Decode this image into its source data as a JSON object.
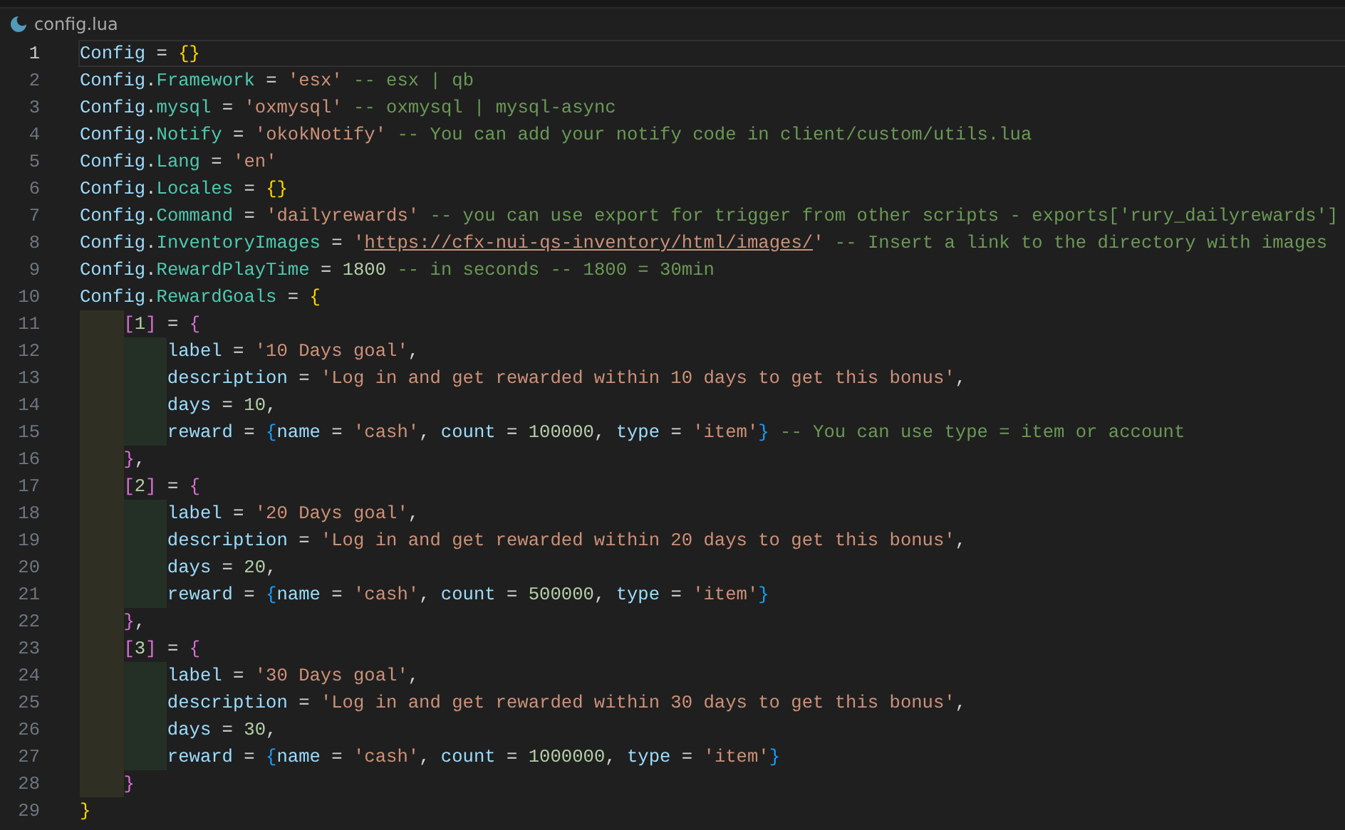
{
  "breadcrumb": {
    "file": "config.lua"
  },
  "lines": [
    {
      "number": "1",
      "active": true,
      "tokens": [
        {
          "kind": "var",
          "text": "Config"
        },
        {
          "kind": "op",
          "text": " = "
        },
        {
          "kind": "brace1",
          "text": "{}"
        }
      ]
    },
    {
      "number": "2",
      "active": false,
      "tokens": [
        {
          "kind": "var",
          "text": "Config"
        },
        {
          "kind": "op",
          "text": "."
        },
        {
          "kind": "field",
          "text": "Framework"
        },
        {
          "kind": "op",
          "text": " = "
        },
        {
          "kind": "str",
          "text": "'esx'"
        },
        {
          "kind": "comment",
          "text": " -- esx | qb"
        }
      ]
    },
    {
      "number": "3",
      "active": false,
      "tokens": [
        {
          "kind": "var",
          "text": "Config"
        },
        {
          "kind": "op",
          "text": "."
        },
        {
          "kind": "field",
          "text": "mysql"
        },
        {
          "kind": "op",
          "text": " = "
        },
        {
          "kind": "str",
          "text": "'oxmysql'"
        },
        {
          "kind": "comment",
          "text": " -- oxmysql | mysql-async"
        }
      ]
    },
    {
      "number": "4",
      "active": false,
      "tokens": [
        {
          "kind": "var",
          "text": "Config"
        },
        {
          "kind": "op",
          "text": "."
        },
        {
          "kind": "field",
          "text": "Notify"
        },
        {
          "kind": "op",
          "text": " = "
        },
        {
          "kind": "str",
          "text": "'okokNotify'"
        },
        {
          "kind": "comment",
          "text": " -- You can add your notify code in client/custom/utils.lua"
        }
      ]
    },
    {
      "number": "5",
      "active": false,
      "tokens": [
        {
          "kind": "var",
          "text": "Config"
        },
        {
          "kind": "op",
          "text": "."
        },
        {
          "kind": "field",
          "text": "Lang"
        },
        {
          "kind": "op",
          "text": " = "
        },
        {
          "kind": "str",
          "text": "'en'"
        }
      ]
    },
    {
      "number": "6",
      "active": false,
      "tokens": [
        {
          "kind": "var",
          "text": "Config"
        },
        {
          "kind": "op",
          "text": "."
        },
        {
          "kind": "field",
          "text": "Locales"
        },
        {
          "kind": "op",
          "text": " = "
        },
        {
          "kind": "brace1",
          "text": "{}"
        }
      ]
    },
    {
      "number": "7",
      "active": false,
      "tokens": [
        {
          "kind": "var",
          "text": "Config"
        },
        {
          "kind": "op",
          "text": "."
        },
        {
          "kind": "field",
          "text": "Command"
        },
        {
          "kind": "op",
          "text": " = "
        },
        {
          "kind": "str",
          "text": "'dailyrewards'"
        },
        {
          "kind": "comment",
          "text": " -- you can use export for trigger from other scripts - exports['rury_dailyrewards']"
        }
      ]
    },
    {
      "number": "8",
      "active": false,
      "tokens": [
        {
          "kind": "var",
          "text": "Config"
        },
        {
          "kind": "op",
          "text": "."
        },
        {
          "kind": "field",
          "text": "InventoryImages"
        },
        {
          "kind": "op",
          "text": " = "
        },
        {
          "kind": "str",
          "text": "'"
        },
        {
          "kind": "link",
          "text": "https://cfx-nui-qs-inventory/html/images/"
        },
        {
          "kind": "str",
          "text": "'"
        },
        {
          "kind": "comment",
          "text": " -- Insert a link to the directory with images"
        }
      ]
    },
    {
      "number": "9",
      "active": false,
      "tokens": [
        {
          "kind": "var",
          "text": "Config"
        },
        {
          "kind": "op",
          "text": "."
        },
        {
          "kind": "field",
          "text": "RewardPlayTime"
        },
        {
          "kind": "op",
          "text": " = "
        },
        {
          "kind": "num",
          "text": "1800"
        },
        {
          "kind": "comment",
          "text": " -- in seconds -- 1800 = 30min"
        }
      ]
    },
    {
      "number": "10",
      "active": false,
      "tokens": [
        {
          "kind": "var",
          "text": "Config"
        },
        {
          "kind": "op",
          "text": "."
        },
        {
          "kind": "field",
          "text": "RewardGoals"
        },
        {
          "kind": "op",
          "text": " = "
        },
        {
          "kind": "brace1",
          "text": "{"
        }
      ]
    },
    {
      "number": "11",
      "active": false,
      "tokens": [
        {
          "kind": "guide1"
        },
        {
          "kind": "brace2",
          "text": "["
        },
        {
          "kind": "num",
          "text": "1"
        },
        {
          "kind": "brace2",
          "text": "]"
        },
        {
          "kind": "op",
          "text": " = "
        },
        {
          "kind": "brace2",
          "text": "{"
        }
      ]
    },
    {
      "number": "12",
      "active": false,
      "tokens": [
        {
          "kind": "guide1"
        },
        {
          "kind": "guide2"
        },
        {
          "kind": "key",
          "text": "label"
        },
        {
          "kind": "op",
          "text": " = "
        },
        {
          "kind": "str",
          "text": "'10 Days goal'"
        },
        {
          "kind": "op",
          "text": ","
        }
      ]
    },
    {
      "number": "13",
      "active": false,
      "tokens": [
        {
          "kind": "guide1"
        },
        {
          "kind": "guide2"
        },
        {
          "kind": "key",
          "text": "description"
        },
        {
          "kind": "op",
          "text": " = "
        },
        {
          "kind": "str",
          "text": "'Log in and get rewarded within 10 days to get this bonus'"
        },
        {
          "kind": "op",
          "text": ","
        }
      ]
    },
    {
      "number": "14",
      "active": false,
      "tokens": [
        {
          "kind": "guide1"
        },
        {
          "kind": "guide2"
        },
        {
          "kind": "key",
          "text": "days"
        },
        {
          "kind": "op",
          "text": " = "
        },
        {
          "kind": "num",
          "text": "10"
        },
        {
          "kind": "op",
          "text": ","
        }
      ]
    },
    {
      "number": "15",
      "active": false,
      "tokens": [
        {
          "kind": "guide1"
        },
        {
          "kind": "guide2"
        },
        {
          "kind": "key",
          "text": "reward"
        },
        {
          "kind": "op",
          "text": " = "
        },
        {
          "kind": "brace3",
          "text": "{"
        },
        {
          "kind": "key",
          "text": "name"
        },
        {
          "kind": "op",
          "text": " = "
        },
        {
          "kind": "str",
          "text": "'cash'"
        },
        {
          "kind": "op",
          "text": ", "
        },
        {
          "kind": "key",
          "text": "count"
        },
        {
          "kind": "op",
          "text": " = "
        },
        {
          "kind": "num",
          "text": "100000"
        },
        {
          "kind": "op",
          "text": ", "
        },
        {
          "kind": "key",
          "text": "type"
        },
        {
          "kind": "op",
          "text": " = "
        },
        {
          "kind": "str",
          "text": "'item'"
        },
        {
          "kind": "brace3",
          "text": "}"
        },
        {
          "kind": "comment",
          "text": " -- You can use type = item or account"
        }
      ]
    },
    {
      "number": "16",
      "active": false,
      "tokens": [
        {
          "kind": "guide1"
        },
        {
          "kind": "brace2",
          "text": "}"
        },
        {
          "kind": "op",
          "text": ","
        }
      ]
    },
    {
      "number": "17",
      "active": false,
      "tokens": [
        {
          "kind": "guide1"
        },
        {
          "kind": "brace2",
          "text": "["
        },
        {
          "kind": "num",
          "text": "2"
        },
        {
          "kind": "brace2",
          "text": "]"
        },
        {
          "kind": "op",
          "text": " = "
        },
        {
          "kind": "brace2",
          "text": "{"
        }
      ]
    },
    {
      "number": "18",
      "active": false,
      "tokens": [
        {
          "kind": "guide1"
        },
        {
          "kind": "guide2"
        },
        {
          "kind": "key",
          "text": "label"
        },
        {
          "kind": "op",
          "text": " = "
        },
        {
          "kind": "str",
          "text": "'20 Days goal'"
        },
        {
          "kind": "op",
          "text": ","
        }
      ]
    },
    {
      "number": "19",
      "active": false,
      "tokens": [
        {
          "kind": "guide1"
        },
        {
          "kind": "guide2"
        },
        {
          "kind": "key",
          "text": "description"
        },
        {
          "kind": "op",
          "text": " = "
        },
        {
          "kind": "str",
          "text": "'Log in and get rewarded within 20 days to get this bonus'"
        },
        {
          "kind": "op",
          "text": ","
        }
      ]
    },
    {
      "number": "20",
      "active": false,
      "tokens": [
        {
          "kind": "guide1"
        },
        {
          "kind": "guide2"
        },
        {
          "kind": "key",
          "text": "days"
        },
        {
          "kind": "op",
          "text": " = "
        },
        {
          "kind": "num",
          "text": "20"
        },
        {
          "kind": "op",
          "text": ","
        }
      ]
    },
    {
      "number": "21",
      "active": false,
      "tokens": [
        {
          "kind": "guide1"
        },
        {
          "kind": "guide2"
        },
        {
          "kind": "key",
          "text": "reward"
        },
        {
          "kind": "op",
          "text": " = "
        },
        {
          "kind": "brace3",
          "text": "{"
        },
        {
          "kind": "key",
          "text": "name"
        },
        {
          "kind": "op",
          "text": " = "
        },
        {
          "kind": "str",
          "text": "'cash'"
        },
        {
          "kind": "op",
          "text": ", "
        },
        {
          "kind": "key",
          "text": "count"
        },
        {
          "kind": "op",
          "text": " = "
        },
        {
          "kind": "num",
          "text": "500000"
        },
        {
          "kind": "op",
          "text": ", "
        },
        {
          "kind": "key",
          "text": "type"
        },
        {
          "kind": "op",
          "text": " = "
        },
        {
          "kind": "str",
          "text": "'item'"
        },
        {
          "kind": "brace3",
          "text": "}"
        }
      ]
    },
    {
      "number": "22",
      "active": false,
      "tokens": [
        {
          "kind": "guide1"
        },
        {
          "kind": "brace2",
          "text": "}"
        },
        {
          "kind": "op",
          "text": ","
        }
      ]
    },
    {
      "number": "23",
      "active": false,
      "tokens": [
        {
          "kind": "guide1"
        },
        {
          "kind": "brace2",
          "text": "["
        },
        {
          "kind": "num",
          "text": "3"
        },
        {
          "kind": "brace2",
          "text": "]"
        },
        {
          "kind": "op",
          "text": " = "
        },
        {
          "kind": "brace2",
          "text": "{"
        }
      ]
    },
    {
      "number": "24",
      "active": false,
      "tokens": [
        {
          "kind": "guide1"
        },
        {
          "kind": "guide2"
        },
        {
          "kind": "key",
          "text": "label"
        },
        {
          "kind": "op",
          "text": " = "
        },
        {
          "kind": "str",
          "text": "'30 Days goal'"
        },
        {
          "kind": "op",
          "text": ","
        }
      ]
    },
    {
      "number": "25",
      "active": false,
      "tokens": [
        {
          "kind": "guide1"
        },
        {
          "kind": "guide2"
        },
        {
          "kind": "key",
          "text": "description"
        },
        {
          "kind": "op",
          "text": " = "
        },
        {
          "kind": "str",
          "text": "'Log in and get rewarded within 30 days to get this bonus'"
        },
        {
          "kind": "op",
          "text": ","
        }
      ]
    },
    {
      "number": "26",
      "active": false,
      "tokens": [
        {
          "kind": "guide1"
        },
        {
          "kind": "guide2"
        },
        {
          "kind": "key",
          "text": "days"
        },
        {
          "kind": "op",
          "text": " = "
        },
        {
          "kind": "num",
          "text": "30"
        },
        {
          "kind": "op",
          "text": ","
        }
      ]
    },
    {
      "number": "27",
      "active": false,
      "tokens": [
        {
          "kind": "guide1"
        },
        {
          "kind": "guide2"
        },
        {
          "kind": "key",
          "text": "reward"
        },
        {
          "kind": "op",
          "text": " = "
        },
        {
          "kind": "brace3",
          "text": "{"
        },
        {
          "kind": "key",
          "text": "name"
        },
        {
          "kind": "op",
          "text": " = "
        },
        {
          "kind": "str",
          "text": "'cash'"
        },
        {
          "kind": "op",
          "text": ", "
        },
        {
          "kind": "key",
          "text": "count"
        },
        {
          "kind": "op",
          "text": " = "
        },
        {
          "kind": "num",
          "text": "1000000"
        },
        {
          "kind": "op",
          "text": ", "
        },
        {
          "kind": "key",
          "text": "type"
        },
        {
          "kind": "op",
          "text": " = "
        },
        {
          "kind": "str",
          "text": "'item'"
        },
        {
          "kind": "brace3",
          "text": "}"
        }
      ]
    },
    {
      "number": "28",
      "active": false,
      "tokens": [
        {
          "kind": "guide1"
        },
        {
          "kind": "brace2",
          "text": "}"
        }
      ]
    },
    {
      "number": "29",
      "active": false,
      "tokens": [
        {
          "kind": "brace1",
          "text": "}"
        }
      ]
    }
  ]
}
